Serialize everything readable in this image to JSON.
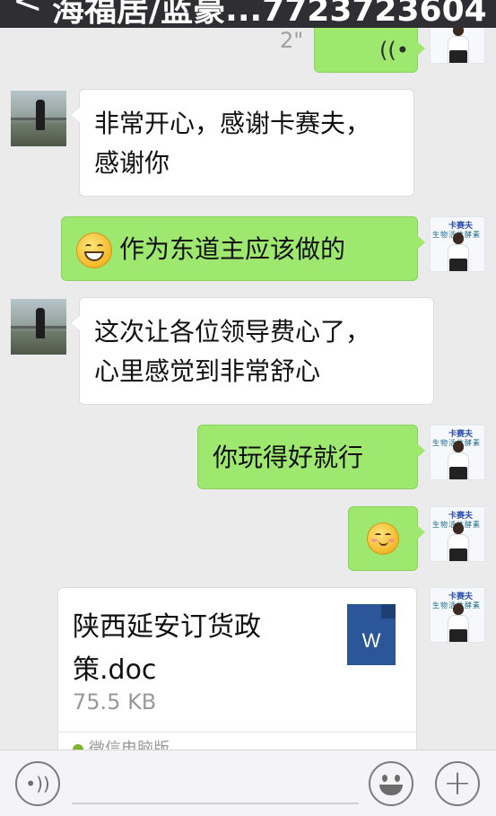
{
  "header": {
    "back_glyph": "<",
    "title": "海福居/蓝豪...7723723604"
  },
  "messages": [
    {
      "side": "right",
      "type": "voice",
      "duration": "2\"",
      "wave": "((•"
    },
    {
      "side": "left",
      "type": "text",
      "lines": [
        "非常开心，感谢卡赛夫，",
        "感谢你"
      ]
    },
    {
      "side": "right",
      "type": "text",
      "emoji": "grin-emoji",
      "text": "作为东道主应该做的"
    },
    {
      "side": "left",
      "type": "text",
      "lines": [
        "这次让各位领导费心了，",
        "心里感觉到非常舒心"
      ]
    },
    {
      "side": "right",
      "type": "text",
      "text": "你玩得好就行"
    },
    {
      "side": "right",
      "type": "emoji",
      "emoji": "blush-emoji"
    },
    {
      "side": "right",
      "type": "file",
      "file_name_lines": [
        "陕西延安订货政",
        "策.doc"
      ],
      "file_size": "75.5 KB",
      "source": "微信电脑版",
      "icon": "word-doc-icon",
      "icon_letter": "W"
    }
  ],
  "avatar_right": {
    "brand": "卡赛夫",
    "sub": "生物活体酵素"
  },
  "bottom": {
    "voice_glyph": "•))",
    "plus_glyph": "+"
  },
  "colors": {
    "green_bubble": "#9ee870",
    "titlebar": "#2e2e33",
    "word_blue": "#2b579a"
  }
}
